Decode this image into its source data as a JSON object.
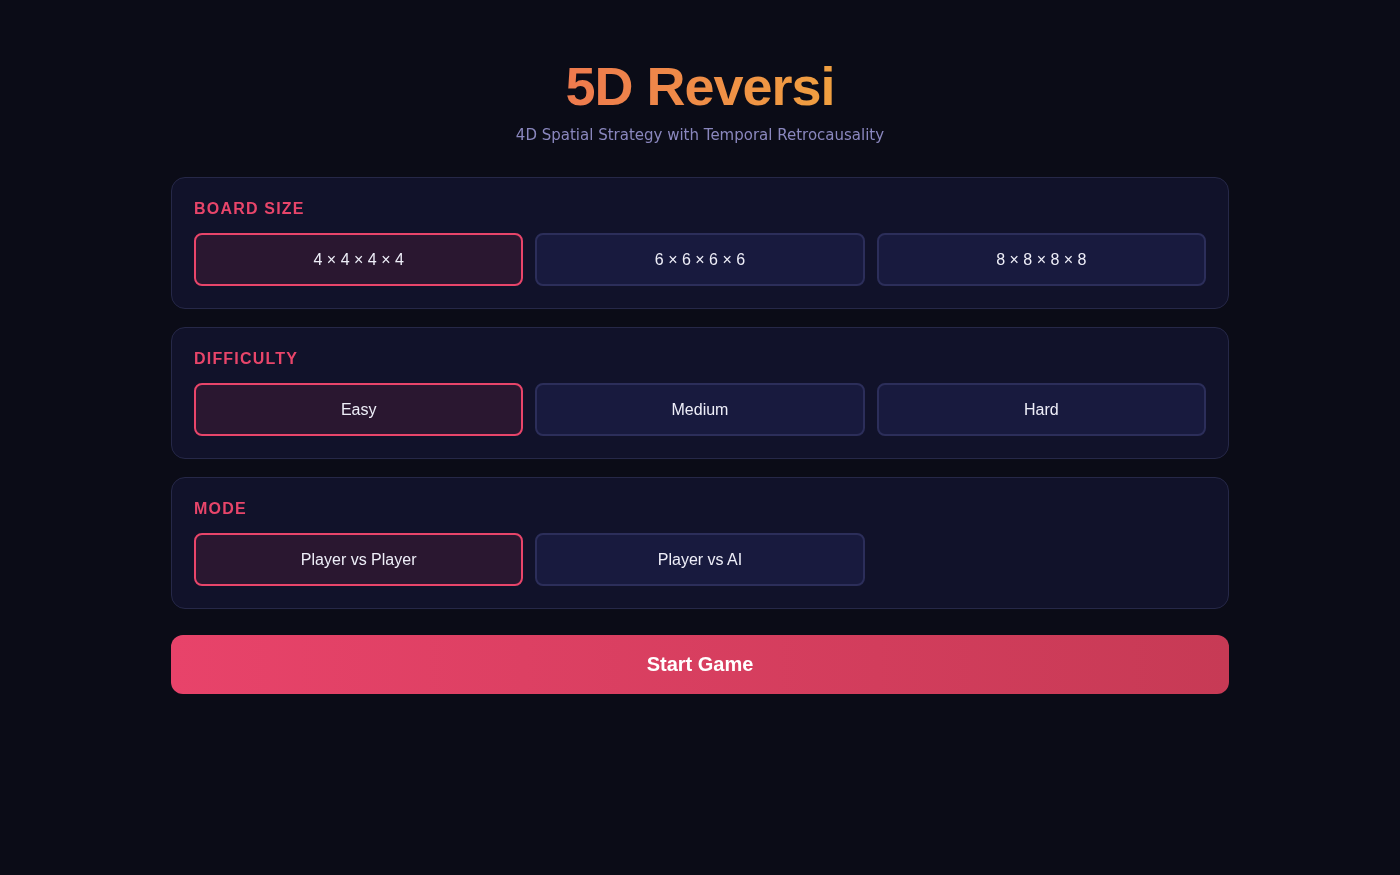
{
  "title": "5D Reversi",
  "subtitle": "4D Spatial Strategy with Temporal Retrocausality",
  "sections": [
    {
      "label": "BOARD SIZE",
      "options": [
        {
          "label": "4 × 4 × 4 × 4",
          "selected": true
        },
        {
          "label": "6 × 6 × 6 × 6",
          "selected": false
        },
        {
          "label": "8 × 8 × 8 × 8",
          "selected": false
        }
      ]
    },
    {
      "label": "DIFFICULTY",
      "options": [
        {
          "label": "Easy",
          "selected": true
        },
        {
          "label": "Medium",
          "selected": false
        },
        {
          "label": "Hard",
          "selected": false
        }
      ]
    },
    {
      "label": "MODE",
      "options": [
        {
          "label": "Player vs Player",
          "selected": true
        },
        {
          "label": "Player vs AI",
          "selected": false
        }
      ]
    }
  ],
  "start_button": "Start Game"
}
